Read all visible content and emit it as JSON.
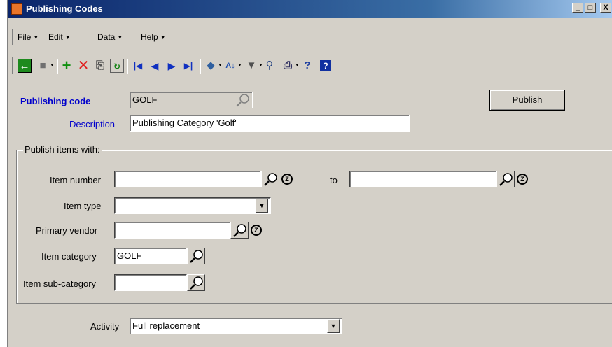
{
  "window": {
    "title": "Publishing Codes",
    "controls": {
      "minimize": "_",
      "maximize": "□",
      "close": "X"
    }
  },
  "menu": {
    "items": [
      {
        "label": "File"
      },
      {
        "label": "Edit"
      },
      {
        "label": "Data"
      },
      {
        "label": "Help"
      }
    ]
  },
  "toolbar": {
    "icons": [
      "back-icon",
      "save-icon",
      "add-icon",
      "delete-icon",
      "copy-icon",
      "refresh-icon",
      "first-record-icon",
      "previous-record-icon",
      "next-record-icon",
      "last-record-icon",
      "book-icon",
      "sort-icon",
      "filter-icon",
      "find-icon",
      "print-icon",
      "help-pointer-icon",
      "help-icon"
    ]
  },
  "form": {
    "publishing_code": {
      "label": "Publishing code",
      "value": "GOLF"
    },
    "description": {
      "label": "Description",
      "value": "Publishing Category 'Golf'"
    },
    "publish_button": "Publish",
    "group_title": "Publish items with:",
    "item_number": {
      "label": "Item number",
      "value": "",
      "to_label": "to",
      "to_value": ""
    },
    "item_type": {
      "label": "Item type",
      "value": ""
    },
    "primary_vendor": {
      "label": "Primary vendor",
      "value": ""
    },
    "item_category": {
      "label": "Item category",
      "value": "GOLF"
    },
    "item_subcategory": {
      "label": "Item sub-category",
      "value": ""
    },
    "activity": {
      "label": "Activity",
      "value": "Full replacement"
    }
  },
  "colors": {
    "title_bar": "#0a246a",
    "label_blue": "#0000cc",
    "face": "#d4d0c8"
  }
}
